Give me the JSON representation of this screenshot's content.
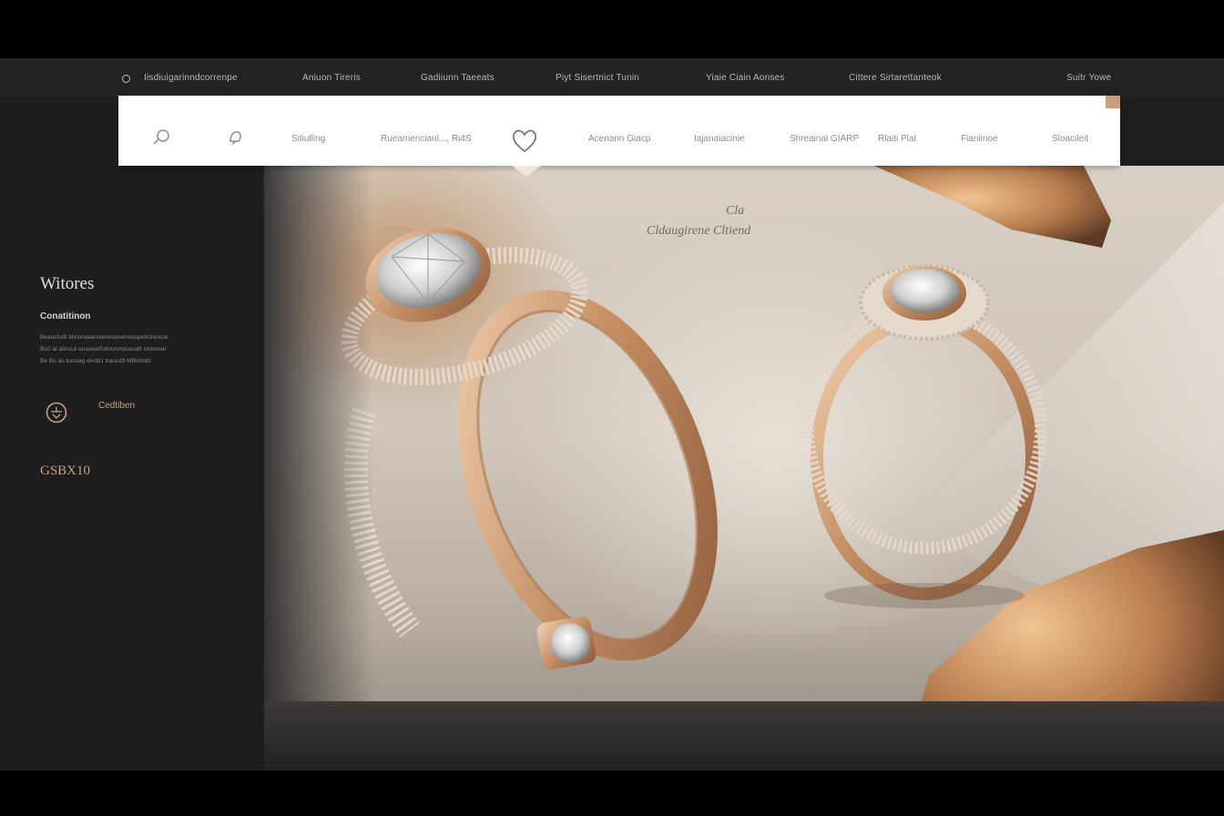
{
  "topbar": {
    "links": [
      "Iisdiuigarinndcorrenpe",
      "Aniuon Tireris",
      "Gadiiunn Taeeats",
      "Piyt Sisertnict Tunin",
      "Yiaie Ciain Aonses",
      "Cittere Sirtarettanteok",
      "Suitr Yowe"
    ]
  },
  "navbar": {
    "items": [
      "Sitiulling",
      "Rueamencianl..., Ri4S",
      "Acenann Giacp",
      "Iajanaiacinie",
      "Shreainal GIARP",
      "Rlaiti Plat",
      "Fianiinoe",
      "Sloacileit"
    ],
    "icons": [
      "search-icon",
      "bell-icon",
      "heart-icon"
    ]
  },
  "sidebar": {
    "title": "Witores",
    "subtitle": "Conatitinon",
    "body_lines": [
      "Beaosfut8 Minoniaiannierinstinemetopetlctinnical",
      "Bo2 at alinsuii enaseaiSolnotonsceoatt ctonneal",
      "Be Bo au luesiag elvdd1 bauiut9 MBIolvds"
    ],
    "badge_label": "Cedtiben",
    "price": "GSBX10"
  },
  "hero": {
    "tagline_line1": "Cla",
    "tagline_line2": "Cldaugirene Cltiend"
  },
  "colors": {
    "accent": "#c89f7a",
    "gold": "#c9a27b",
    "dark": "#1e1e21"
  }
}
